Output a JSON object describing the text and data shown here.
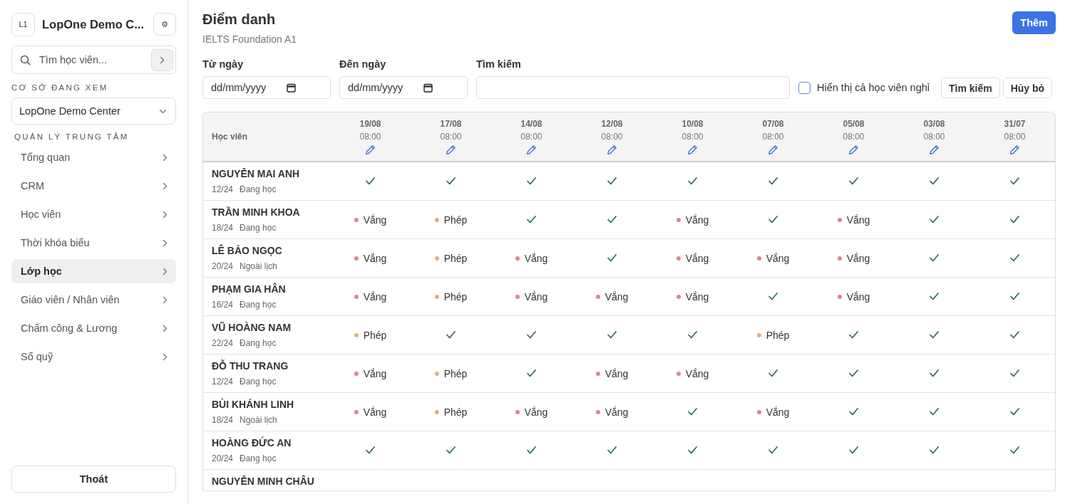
{
  "sidebar": {
    "logo": "L1",
    "title": "LopOne Demo C...",
    "search": {
      "placeholder": "Tìm học viên..."
    },
    "branch_label": "CƠ SỞ ĐANG XEM",
    "branch": "LopOne Demo Center",
    "section_label": "QUẢN LÝ TRUNG TÂM",
    "items": [
      {
        "label": "Tổng quan",
        "selected": false
      },
      {
        "label": "CRM",
        "selected": false
      },
      {
        "label": "Học viên",
        "selected": false
      },
      {
        "label": "Thời khóa biểu",
        "selected": false
      },
      {
        "label": "Lớp học",
        "selected": true
      },
      {
        "label": "Giáo viên / Nhân viên",
        "selected": false
      },
      {
        "label": "Chấm công & Lương",
        "selected": false
      },
      {
        "label": "Sổ quỹ",
        "selected": false
      }
    ],
    "logout": "Thoát"
  },
  "header": {
    "title": "Điểm danh",
    "subtitle": "IELTS Foundation A1",
    "add_button": "Thêm"
  },
  "filters": {
    "from_label": "Từ ngày",
    "from_placeholder": "dd/mm/yyyy",
    "to_label": "Đến ngày",
    "to_placeholder": "dd/mm/yyyy",
    "search_label": "Tìm kiếm",
    "show_inactive": {
      "label": "Hiển thị cả học viên nghỉ",
      "checked": false
    },
    "search_button": "Tìm kiếm",
    "cancel_button": "Hủy bỏ"
  },
  "table": {
    "first_column": "Học viên",
    "sessions": [
      {
        "date": "19/08",
        "time": "08:00"
      },
      {
        "date": "17/08",
        "time": "08:00"
      },
      {
        "date": "14/08",
        "time": "08:00"
      },
      {
        "date": "12/08",
        "time": "08:00"
      },
      {
        "date": "10/08",
        "time": "08:00"
      },
      {
        "date": "07/08",
        "time": "08:00"
      },
      {
        "date": "05/08",
        "time": "08:00"
      },
      {
        "date": "03/08",
        "time": "08:00"
      },
      {
        "date": "31/07",
        "time": "08:00"
      }
    ],
    "rows": [
      {
        "name": "NGUYỄN MAI ANH",
        "count": "12/24",
        "status": "Đang học",
        "cells": [
          {
            "kind": "present"
          },
          {
            "kind": "present"
          },
          {
            "kind": "present"
          },
          {
            "kind": "present"
          },
          {
            "kind": "present"
          },
          {
            "kind": "present"
          },
          {
            "kind": "present"
          },
          {
            "kind": "present"
          },
          {
            "kind": "present"
          }
        ]
      },
      {
        "name": "TRẦN MINH KHOA",
        "count": "18/24",
        "status": "Đang học",
        "cells": [
          {
            "kind": "absent",
            "label": "Vắng",
            "color": "#e08683"
          },
          {
            "kind": "excused",
            "label": "Phép",
            "color": "#e0b07f"
          },
          {
            "kind": "present"
          },
          {
            "kind": "present"
          },
          {
            "kind": "absent",
            "label": "Vắng",
            "color": "#e08683"
          },
          {
            "kind": "present"
          },
          {
            "kind": "absent",
            "label": "Vắng",
            "color": "#e08683"
          },
          {
            "kind": "present"
          },
          {
            "kind": "present"
          }
        ]
      },
      {
        "name": "LÊ BẢO NGỌC",
        "count": "20/24",
        "status": "Ngoài lịch",
        "cells": [
          {
            "kind": "absent",
            "label": "Vắng",
            "color": "#e08683"
          },
          {
            "kind": "excused",
            "label": "Phép",
            "color": "#e0b07f"
          },
          {
            "kind": "absent",
            "label": "Vắng",
            "color": "#e08683"
          },
          {
            "kind": "present"
          },
          {
            "kind": "absent",
            "label": "Vắng",
            "color": "#e08683"
          },
          {
            "kind": "absent",
            "label": "Vắng",
            "color": "#e08683"
          },
          {
            "kind": "absent",
            "label": "Vắng",
            "color": "#e08683"
          },
          {
            "kind": "present"
          },
          {
            "kind": "present"
          }
        ]
      },
      {
        "name": "PHẠM GIA HÂN",
        "count": "16/24",
        "status": "Đang học",
        "cells": [
          {
            "kind": "absent",
            "label": "Vắng",
            "color": "#e08683"
          },
          {
            "kind": "excused",
            "label": "Phép",
            "color": "#e0b07f"
          },
          {
            "kind": "absent",
            "label": "Vắng",
            "color": "#e08683"
          },
          {
            "kind": "absent",
            "label": "Vắng",
            "color": "#e08683"
          },
          {
            "kind": "absent",
            "label": "Vắng",
            "color": "#e08683"
          },
          {
            "kind": "present"
          },
          {
            "kind": "absent",
            "label": "Vắng",
            "color": "#e08683"
          },
          {
            "kind": "present"
          },
          {
            "kind": "present"
          }
        ]
      },
      {
        "name": "VŨ HOÀNG NAM",
        "count": "22/24",
        "status": "Đang học",
        "cells": [
          {
            "kind": "excused",
            "label": "Phép",
            "color": "#e0b07f"
          },
          {
            "kind": "present"
          },
          {
            "kind": "present"
          },
          {
            "kind": "present"
          },
          {
            "kind": "present"
          },
          {
            "kind": "excused",
            "label": "Phép",
            "color": "#e0b07f"
          },
          {
            "kind": "present"
          },
          {
            "kind": "present"
          },
          {
            "kind": "present"
          }
        ]
      },
      {
        "name": "ĐỖ THU TRANG",
        "count": "12/24",
        "status": "Đang học",
        "cells": [
          {
            "kind": "absent",
            "label": "Vắng",
            "color": "#e08683"
          },
          {
            "kind": "excused",
            "label": "Phép",
            "color": "#e0b07f"
          },
          {
            "kind": "present"
          },
          {
            "kind": "absent",
            "label": "Vắng",
            "color": "#e08683"
          },
          {
            "kind": "absent",
            "label": "Vắng",
            "color": "#e08683"
          },
          {
            "kind": "present"
          },
          {
            "kind": "present"
          },
          {
            "kind": "present"
          },
          {
            "kind": "present"
          }
        ]
      },
      {
        "name": "BÙI KHÁNH LINH",
        "count": "18/24",
        "status": "Ngoài lịch",
        "cells": [
          {
            "kind": "absent",
            "label": "Vắng",
            "color": "#e08683"
          },
          {
            "kind": "excused",
            "label": "Phép",
            "color": "#e0b07f"
          },
          {
            "kind": "absent",
            "label": "Vắng",
            "color": "#e08683"
          },
          {
            "kind": "absent",
            "label": "Vắng",
            "color": "#e08683"
          },
          {
            "kind": "present"
          },
          {
            "kind": "absent",
            "label": "Vắng",
            "color": "#e08683"
          },
          {
            "kind": "present"
          },
          {
            "kind": "present"
          },
          {
            "kind": "present"
          }
        ]
      },
      {
        "name": "HOÀNG ĐỨC AN",
        "count": "20/24",
        "status": "Đang học",
        "cells": [
          {
            "kind": "present"
          },
          {
            "kind": "present"
          },
          {
            "kind": "present"
          },
          {
            "kind": "present"
          },
          {
            "kind": "present"
          },
          {
            "kind": "present"
          },
          {
            "kind": "present"
          },
          {
            "kind": "present"
          },
          {
            "kind": "present"
          }
        ]
      },
      {
        "name": "NGUYỄN MINH CHÂU"
      }
    ]
  }
}
